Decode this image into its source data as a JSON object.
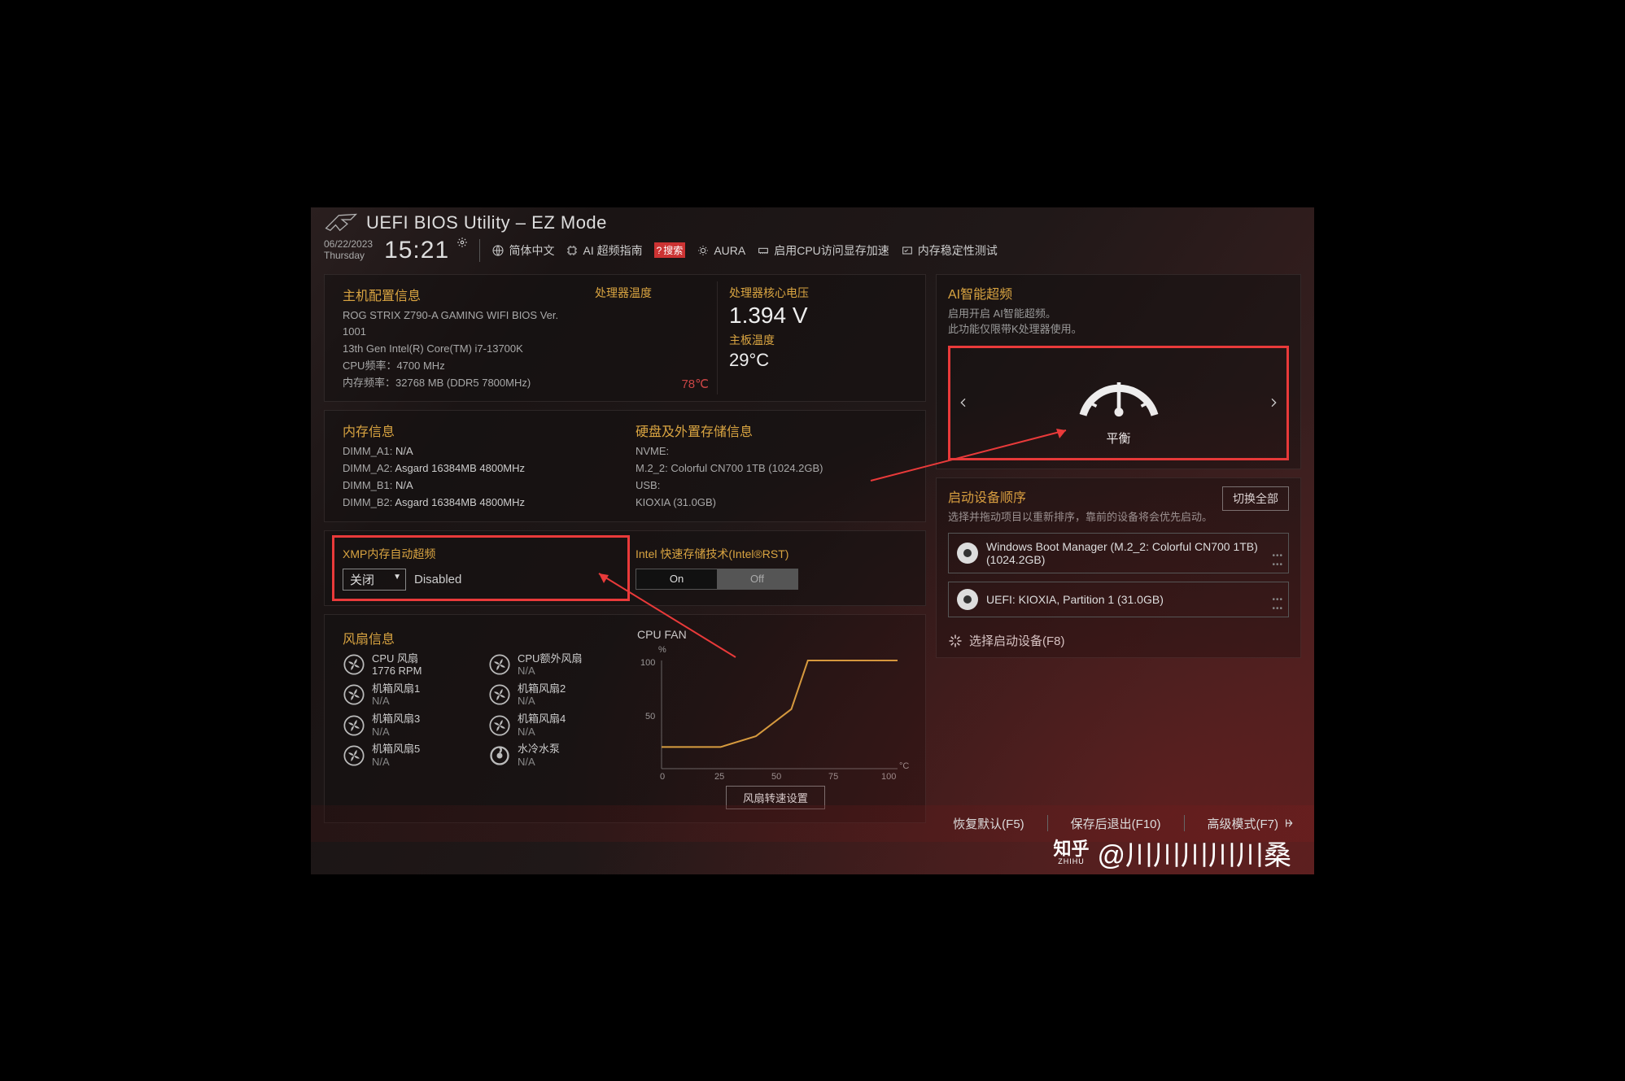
{
  "header": {
    "title": "UEFI BIOS Utility – EZ Mode",
    "date": "06/22/2023",
    "day": "Thursday",
    "time": "15:21"
  },
  "toolbar": {
    "lang": "简体中文",
    "ai_guide": "AI 超频指南",
    "search": "搜索",
    "aura": "AURA",
    "cpu_mem_accel": "启用CPU访问显存加速",
    "mem_stability": "内存稳定性测试"
  },
  "sysinfo": {
    "title": "主机配置信息",
    "board": "ROG STRIX Z790-A GAMING WIFI    BIOS Ver. 1001",
    "cpu": "13th Gen Intel(R) Core(TM) i7-13700K",
    "cpu_freq_label": "CPU频率：4700 MHz",
    "mem_freq_label": "内存频率：32768 MB (DDR5 7800MHz)"
  },
  "cpu_temp": {
    "title": "处理器温度",
    "value": "78℃"
  },
  "vcore": {
    "title": "处理器核心电压",
    "value": "1.394 V",
    "mb_temp_title": "主板温度",
    "mb_temp": "29°C"
  },
  "memory": {
    "title": "内存信息",
    "slots": [
      {
        "name": "DIMM_A1:",
        "val": "N/A"
      },
      {
        "name": "DIMM_A2:",
        "val": "Asgard 16384MB 4800MHz"
      },
      {
        "name": "DIMM_B1:",
        "val": "N/A"
      },
      {
        "name": "DIMM_B2:",
        "val": "Asgard 16384MB 4800MHz"
      }
    ]
  },
  "storage": {
    "title": "硬盘及外置存储信息",
    "nvme_label": "NVME:",
    "nvme": "M.2_2: Colorful CN700 1TB (1024.2GB)",
    "usb_label": "USB:",
    "usb": "KIOXIA (31.0GB)"
  },
  "xmp": {
    "title": "XMP内存自动超频",
    "value": "关闭",
    "status": "Disabled"
  },
  "rst": {
    "title": "Intel 快速存储技术(Intel®RST)",
    "on": "On",
    "off": "Off"
  },
  "fans": {
    "title": "风扇信息",
    "items": [
      {
        "name": "CPU 风扇",
        "val": "1776 RPM"
      },
      {
        "name": "CPU额外风扇",
        "val": "N/A"
      },
      {
        "name": "机箱风扇1",
        "val": "N/A"
      },
      {
        "name": "机箱风扇2",
        "val": "N/A"
      },
      {
        "name": "机箱风扇3",
        "val": "N/A"
      },
      {
        "name": "机箱风扇4",
        "val": "N/A"
      },
      {
        "name": "机箱风扇5",
        "val": "N/A"
      },
      {
        "name": "水冷水泵",
        "val": "N/A"
      }
    ],
    "chart_title": "CPU FAN",
    "button": "风扇转速设置"
  },
  "ai_oc": {
    "title": "AI智能超频",
    "desc1": "启用开启 AI智能超频。",
    "desc2": "此功能仅限带K处理器使用。",
    "mode": "平衡"
  },
  "boot": {
    "title": "启动设备顺序",
    "desc": "选择并拖动项目以重新排序，靠前的设备将会优先启动。",
    "swap": "切换全部",
    "items": [
      "Windows Boot Manager (M.2_2: Colorful CN700 1TB) (1024.2GB)",
      "UEFI: KIOXIA, Partition 1 (31.0GB)"
    ],
    "select_boot": "选择启动设备(F8)"
  },
  "footer": {
    "defaults": "恢复默认(F5)",
    "save_exit": "保存后退出(F10)",
    "advanced": "高级模式(F7)"
  },
  "watermark": "@川川川川川桑",
  "chart_data": {
    "type": "line",
    "title": "CPU FAN",
    "xlabel": "°C",
    "ylabel": "%",
    "xlim": [
      0,
      100
    ],
    "ylim": [
      0,
      100
    ],
    "x_ticks": [
      0,
      25,
      50,
      75,
      100
    ],
    "y_ticks": [
      50,
      100
    ],
    "series": [
      {
        "name": "CPU FAN",
        "points": [
          [
            0,
            20
          ],
          [
            25,
            20
          ],
          [
            40,
            30
          ],
          [
            55,
            55
          ],
          [
            62,
            100
          ],
          [
            100,
            100
          ]
        ]
      }
    ]
  }
}
